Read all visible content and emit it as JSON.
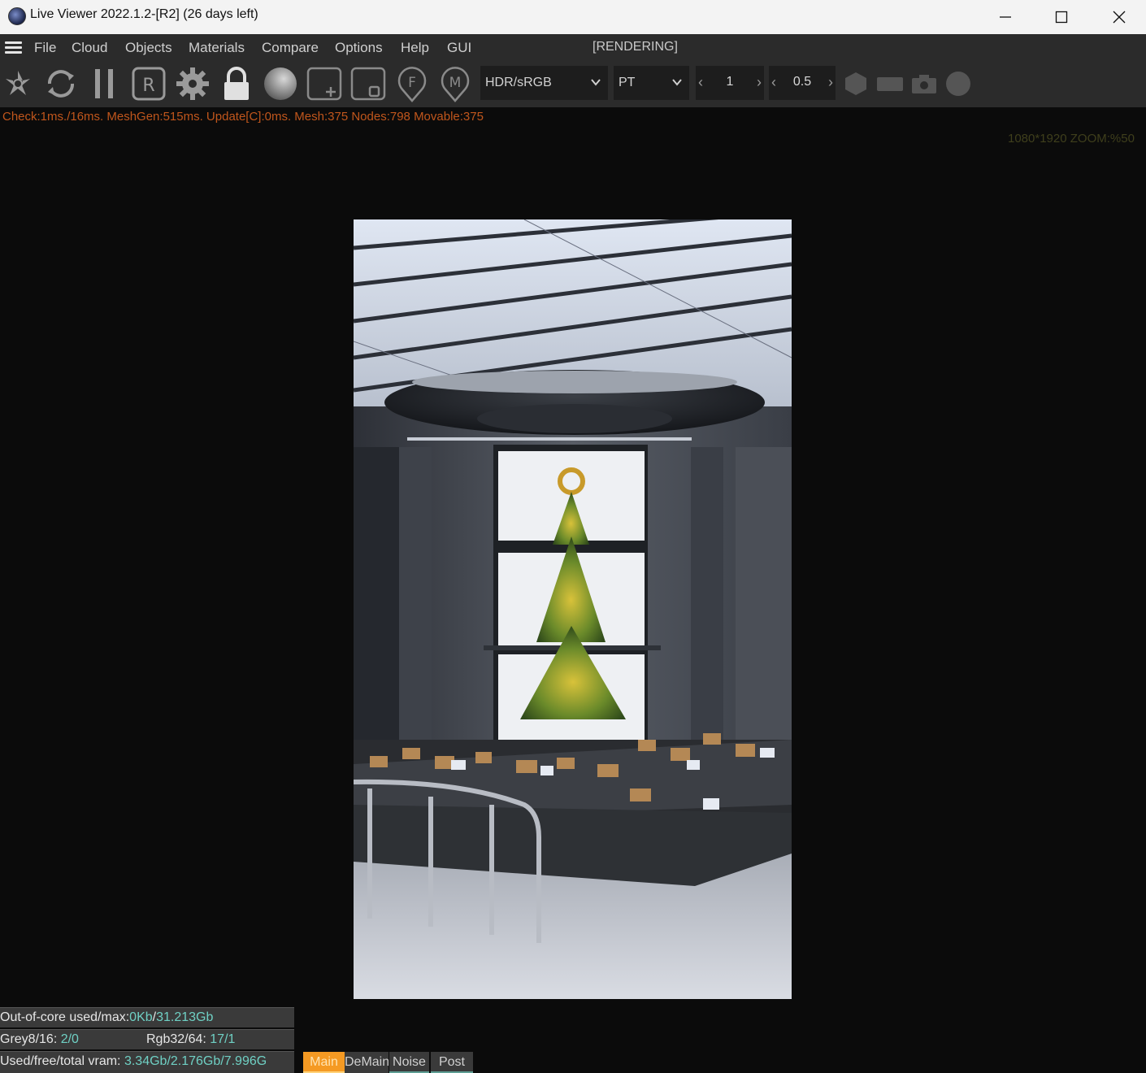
{
  "window": {
    "title": "Live Viewer 2022.1.2-[R2] (26 days left)"
  },
  "menu": {
    "items": [
      "File",
      "Cloud",
      "Objects",
      "Materials",
      "Compare",
      "Options",
      "Help",
      "GUI"
    ],
    "status": "[RENDERING]"
  },
  "toolbar": {
    "icons": [
      "lens-icon",
      "refresh-icon",
      "pause-icon",
      "region-r-icon",
      "gear-icon",
      "lock-icon",
      "sphere-icon",
      "add-box-icon",
      "rect-box-icon",
      "focus-f-icon",
      "material-m-icon",
      "hexagon-icon",
      "rectangle-icon",
      "camera-icon",
      "circle-icon"
    ],
    "color_mode": "HDR/sRGB",
    "kernel": "PT",
    "spinner1_value": "1",
    "spinner2_value": "0.5"
  },
  "stats": {
    "line": "Check:1ms./16ms. MeshGen:515ms. Update[C]:0ms. Mesh:375 Nodes:798 Movable:375"
  },
  "viewport": {
    "resolution_zoom": "1080*1920 ZOOM:%50"
  },
  "info": {
    "ooc_label": "Out-of-core used/max:",
    "ooc_used": "0Kb",
    "ooc_sep": "/",
    "ooc_max": "31.213Gb",
    "grey_label": "Grey8/16: ",
    "grey_value": "2/0",
    "rgb_label": "Rgb32/64: ",
    "rgb_value": "17/1",
    "vram_label": "Used/free/total vram: ",
    "vram_value": "3.34Gb/2.176Gb/7.996G"
  },
  "passes": [
    {
      "label": "Main",
      "active": true
    },
    {
      "label": "DeMain",
      "active": false
    },
    {
      "label": "Noise",
      "active": false
    },
    {
      "label": "Post",
      "active": false
    }
  ],
  "colors": {
    "accent_orange": "#f59a23",
    "stats_text": "#c0561c",
    "info_value": "#6fd0c4"
  }
}
